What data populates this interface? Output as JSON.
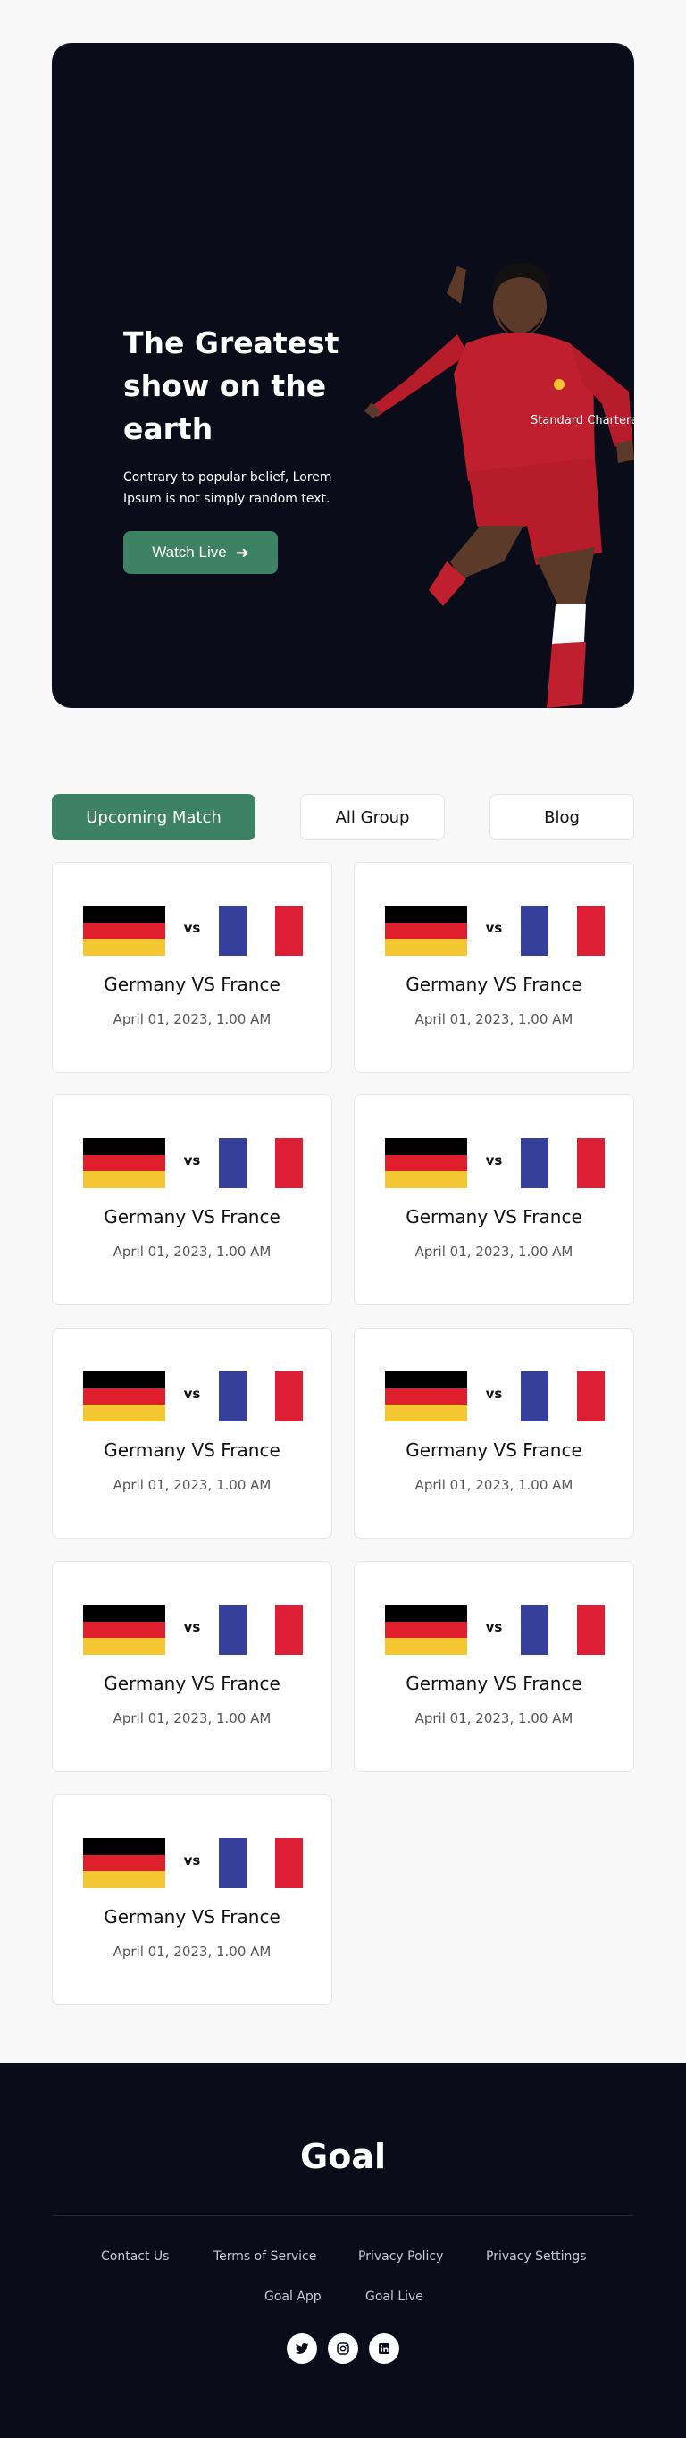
{
  "hero": {
    "title": "The Greatest show on the earth",
    "description": "Contrary to popular belief, Lorem Ipsum is not simply random text.",
    "button_label": "Watch Live",
    "button_icon": "arrow-right-icon",
    "player_image": "footballer in red kit celebrating",
    "sponsor_text": "Standard Chartered"
  },
  "tabs": [
    {
      "label": "Upcoming Match"
    },
    {
      "label": "All Group"
    },
    {
      "label": "Blog"
    }
  ],
  "matches": [
    {
      "title": "Germany VS France",
      "vs": "vs",
      "date": "April 01, 2023, 1.00 AM"
    },
    {
      "title": "Germany VS France",
      "vs": "vs",
      "date": "April 01, 2023, 1.00 AM"
    },
    {
      "title": "Germany VS France",
      "vs": "vs",
      "date": "April 01, 2023, 1.00 AM"
    },
    {
      "title": "Germany VS France",
      "vs": "vs",
      "date": "April 01, 2023, 1.00 AM"
    },
    {
      "title": "Germany VS France",
      "vs": "vs",
      "date": "April 01, 2023, 1.00 AM"
    },
    {
      "title": "Germany VS France",
      "vs": "vs",
      "date": "April 01, 2023, 1.00 AM"
    },
    {
      "title": "Germany VS France",
      "vs": "vs",
      "date": "April 01, 2023, 1.00 AM"
    },
    {
      "title": "Germany VS France",
      "vs": "vs",
      "date": "April 01, 2023, 1.00 AM"
    },
    {
      "title": "Germany VS France",
      "vs": "vs",
      "date": "April 01, 2023, 1.00 AM"
    }
  ],
  "footer": {
    "logo": "Goal",
    "links": [
      "Contact Us",
      "Terms of Service",
      "Privacy Policy",
      "Privacy Settings",
      "Goal App",
      "Goal Live"
    ],
    "socials": [
      "twitter-icon",
      "instagram-icon",
      "linkedin-icon"
    ]
  },
  "colors": {
    "accent": "#3d8264",
    "dark_bg": "#0b0c1a",
    "page_bg": "#f8f8f8"
  }
}
